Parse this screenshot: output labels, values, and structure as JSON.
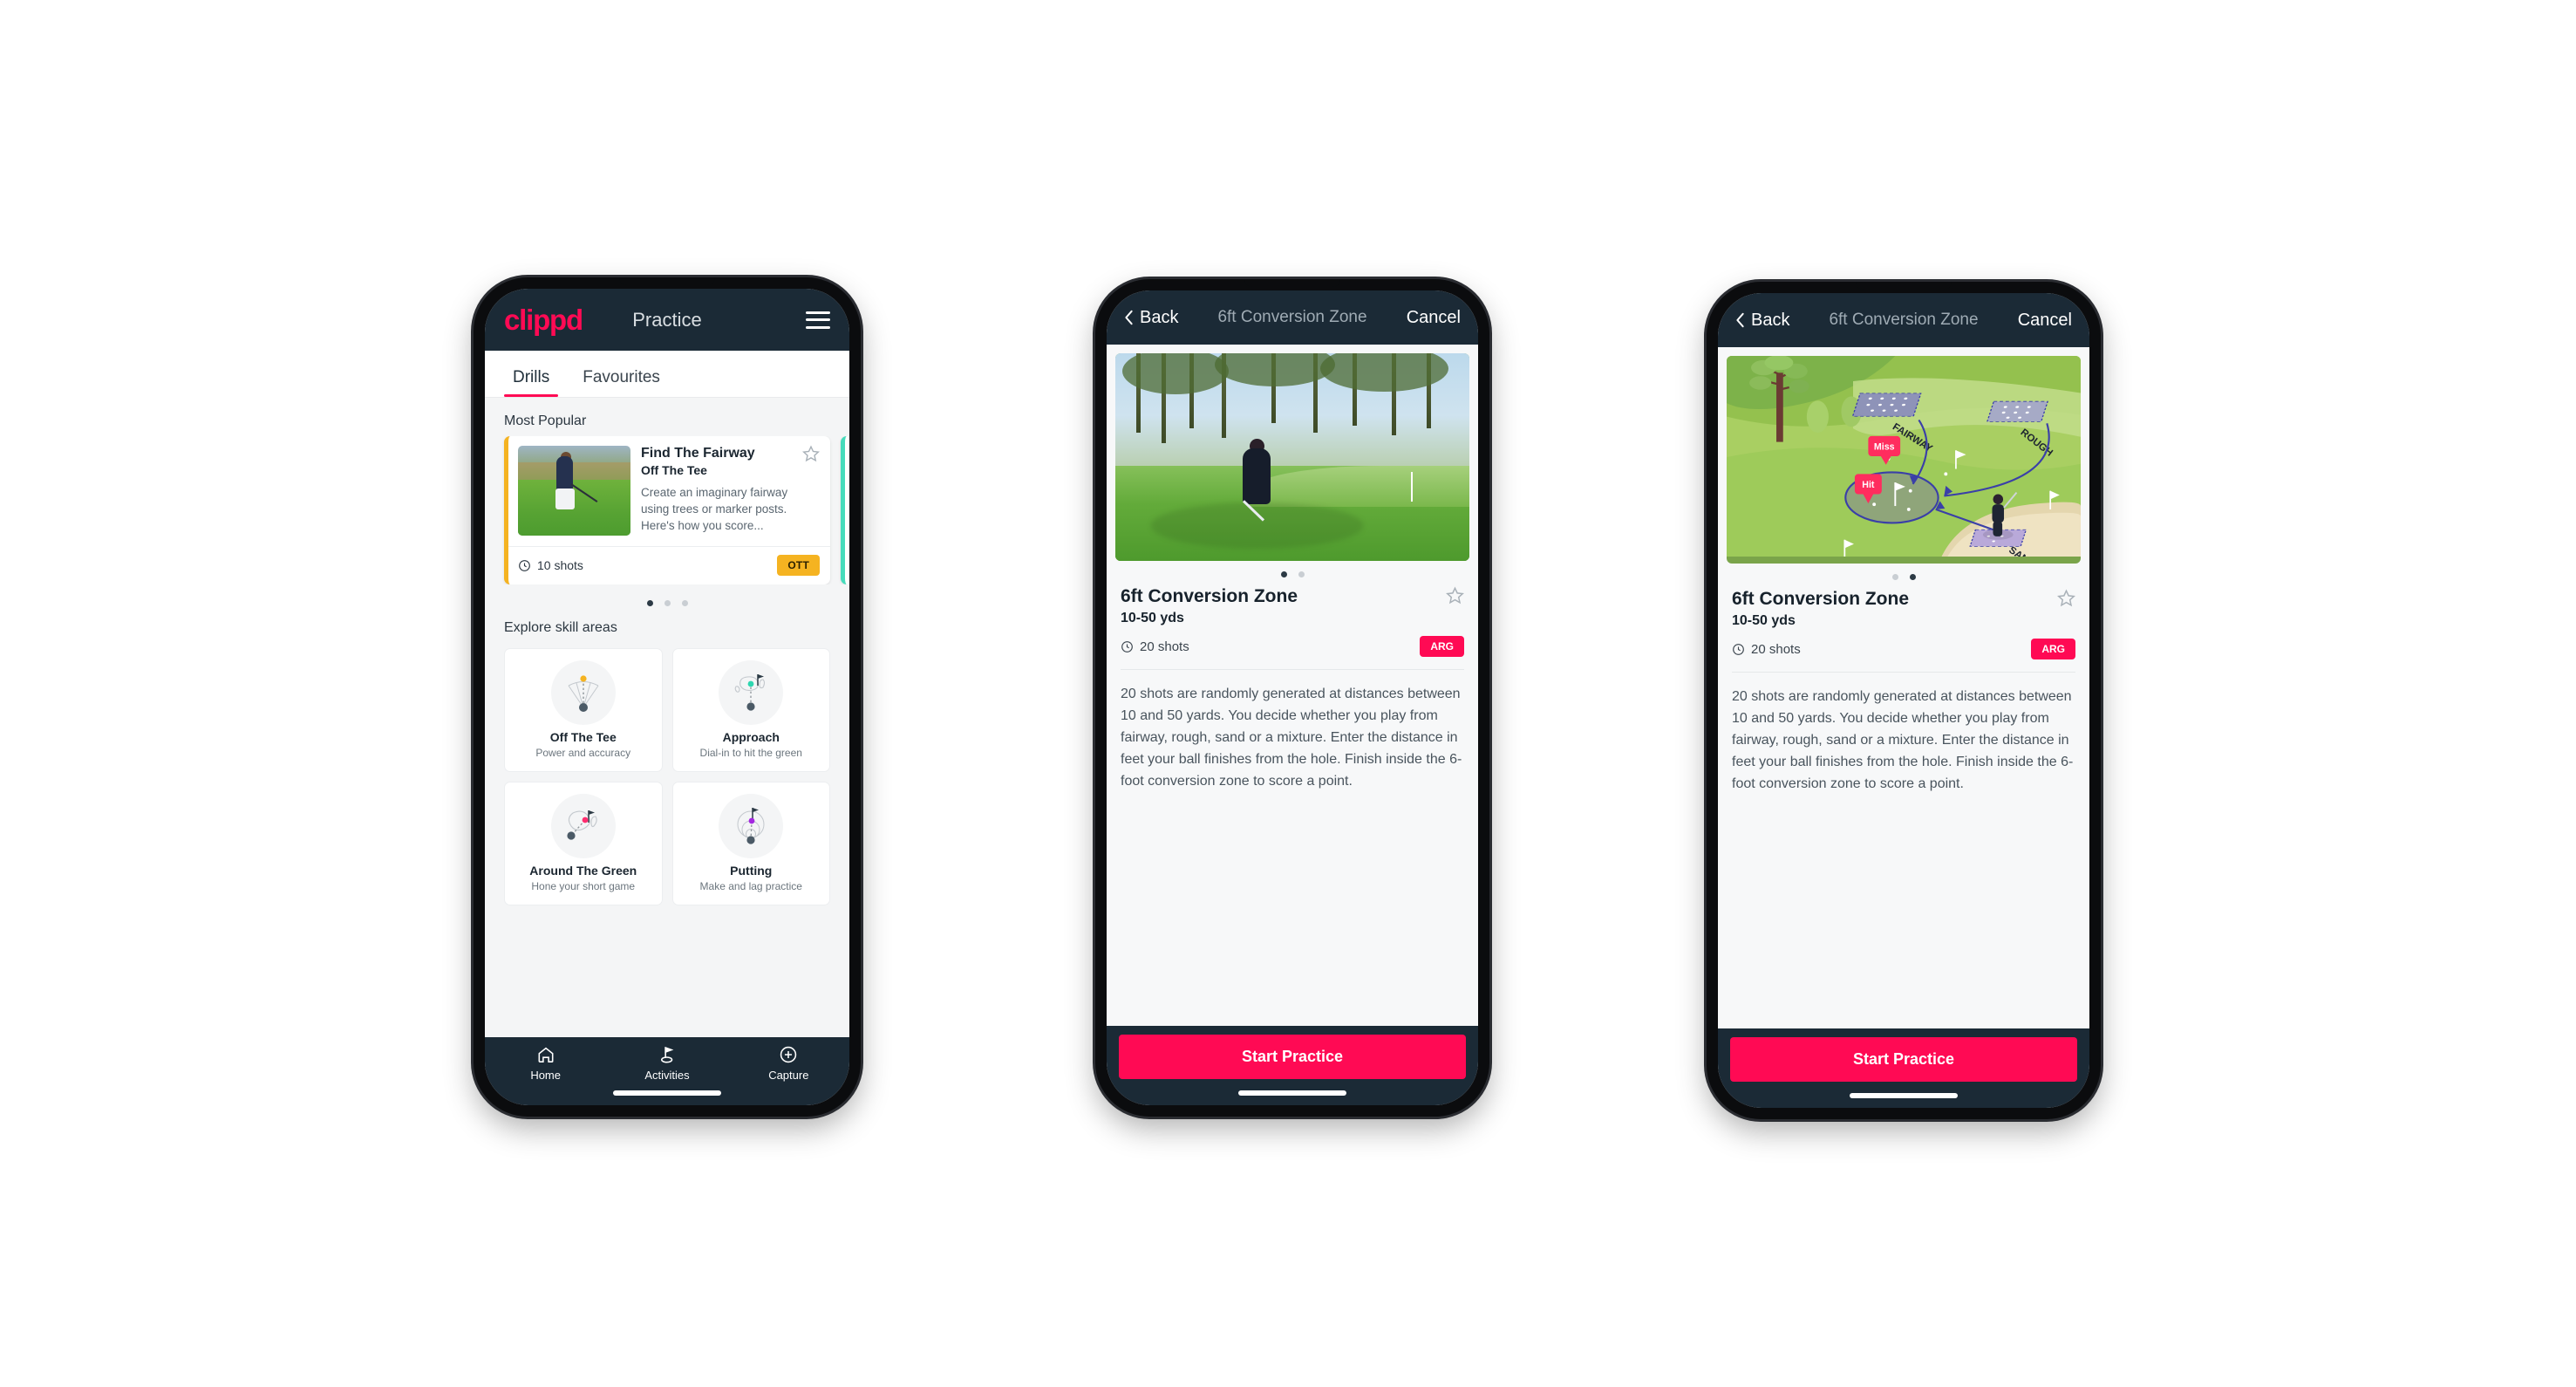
{
  "phone1": {
    "header": {
      "brand": "clippd",
      "title": "Practice",
      "menu_icon": "hamburger-icon"
    },
    "tabs": [
      {
        "label": "Drills",
        "active": true
      },
      {
        "label": "Favourites",
        "active": false
      }
    ],
    "sections": {
      "most_popular_label": "Most Popular",
      "explore_label": "Explore skill areas"
    },
    "drill_card": {
      "name": "Find The Fairway",
      "category": "Off The Tee",
      "description": "Create an imaginary fairway using trees or marker posts. Here's how you score...",
      "shots": "10 shots",
      "badge": "OTT",
      "badge_color": "#f5b321",
      "accent_color": "#f5b321",
      "next_accent_color": "#46dbbb",
      "star_icon": "star-outline-icon",
      "clock_icon": "clock-icon"
    },
    "carousel_dots": {
      "count": 3,
      "active_index": 0
    },
    "skill_areas": [
      {
        "name": "Off The Tee",
        "sub": "Power and accuracy",
        "dot_color": "#f5b321"
      },
      {
        "name": "Approach",
        "sub": "Dial-in to hit the green",
        "dot_color": "#2ed6b0"
      },
      {
        "name": "Around The Green",
        "sub": "Hone your short game",
        "dot_color": "#ff2d6f"
      },
      {
        "name": "Putting",
        "sub": "Make and lag practice",
        "dot_color": "#a428e0"
      }
    ],
    "bottom_nav": [
      {
        "label": "Home",
        "icon": "home-icon",
        "active": false
      },
      {
        "label": "Activities",
        "icon": "golf-flag-icon",
        "active": true
      },
      {
        "label": "Capture",
        "icon": "plus-circle-icon",
        "active": false
      }
    ]
  },
  "phone2": {
    "header": {
      "back": "Back",
      "title": "6ft Conversion Zone",
      "cancel": "Cancel",
      "back_icon": "chevron-left-icon"
    },
    "media_kind": "photo",
    "carousel_dots": {
      "count": 2,
      "active_index": 0
    },
    "detail": {
      "title": "6ft Conversion Zone",
      "yards": "10-50 yds",
      "shots": "20 shots",
      "badge": "ARG",
      "badge_color": "#ff0a54",
      "star_icon": "star-outline-icon",
      "clock_icon": "clock-icon",
      "description": "20 shots are randomly generated at distances between 10 and 50 yards. You decide whether you play from fairway, rough, sand or a mixture. Enter the distance in feet your ball finishes from the hole. Finish inside the 6-foot conversion zone to score a point."
    },
    "cta": "Start Practice"
  },
  "phone3": {
    "header": {
      "back": "Back",
      "title": "6ft Conversion Zone",
      "cancel": "Cancel",
      "back_icon": "chevron-left-icon"
    },
    "media_kind": "illustration",
    "illustration": {
      "zone_labels": [
        "FAIRWAY",
        "ROUGH",
        "SAND"
      ],
      "result_tags": [
        {
          "label": "Miss",
          "color": "#ff2d5e"
        },
        {
          "label": "Hit",
          "color": "#ff2d5e"
        }
      ]
    },
    "carousel_dots": {
      "count": 2,
      "active_index": 1
    },
    "detail": {
      "title": "6ft Conversion Zone",
      "yards": "10-50 yds",
      "shots": "20 shots",
      "badge": "ARG",
      "badge_color": "#ff0a54",
      "star_icon": "star-outline-icon",
      "clock_icon": "clock-icon",
      "description": "20 shots are randomly generated at distances between 10 and 50 yards. You decide whether you play from fairway, rough, sand or a mixture. Enter the distance in feet your ball finishes from the hole. Finish inside the 6-foot conversion zone to score a point."
    },
    "cta": "Start Practice"
  },
  "theme": {
    "navy": "#1b2a36",
    "pink": "#ff0a54",
    "page_bg": "#ffffff",
    "surface": "#f4f5f6"
  }
}
